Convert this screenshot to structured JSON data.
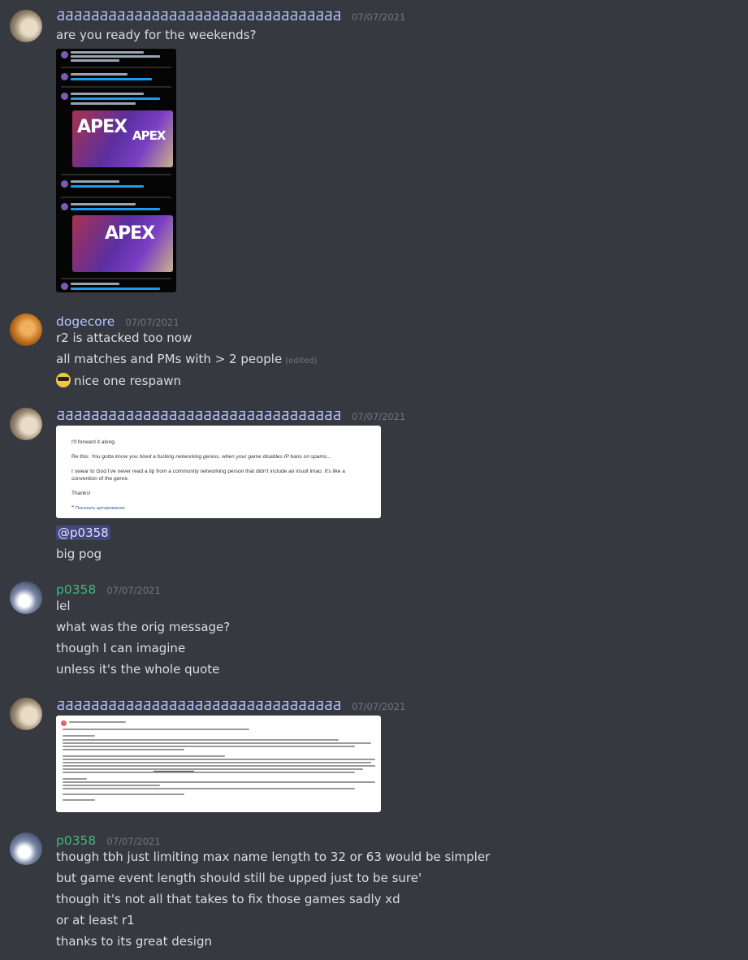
{
  "messages": [
    {
      "author": "ƋƋƋƋƋƋƋƋƋƋƋƋƋƋƋƋƋƋƋƋƋƋƋƋƋƋƋƋƋƋƋƋƋƋƋ",
      "author_display": "ƋƋƋƋƋƋƋƋƋƋƋƋƋƋƋƋƋƋƋƋƋƋƋƋƋƋƋƋƋƋƋƋƋ",
      "timestamp": "07/07/2021",
      "lines": [
        "are you ready for the weekends?"
      ],
      "attachment": "twitter-thread-screenshot"
    },
    {
      "author": "dogecore",
      "timestamp": "07/07/2021",
      "lines": [
        "r2 is attacked too now",
        "all matches and PMs with > 2 people",
        "nice one respawn"
      ],
      "edited_label": "(edited)"
    },
    {
      "author_display": "ƋƋƋƋƋƋƋƋƋƋƋƋƋƋƋƋƋƋƋƋƋƋƋƋƋƋƋƋƋƋƋƋƋ",
      "timestamp": "07/07/2021",
      "email": {
        "line1": "I'll forward it along.",
        "line2_prefix": "Re this: ",
        "line2_italic": "You gotta know you hired a fucking networking genius, when your game disables IP bans on spams...",
        "line3": "I swear to God I've never read a tip from a community networking person that didn't include an insult lmao. It's like a convention of the genre.",
        "line4": "Thanks!",
        "quote_link": "Показать цитирование"
      },
      "mention": "@p0358",
      "lines": [
        "big pog"
      ]
    },
    {
      "author": "p0358",
      "timestamp": "07/07/2021",
      "lines": [
        "lel",
        "what was the orig message?",
        "though I can imagine",
        "unless it's the whole quote"
      ]
    },
    {
      "author_display": "ƋƋƋƋƋƋƋƋƋƋƋƋƋƋƋƋƋƋƋƋƋƋƋƋƋƋƋƋƋƋƋƋƋ",
      "timestamp": "07/07/2021",
      "attachment": "long-email-screenshot"
    },
    {
      "author": "p0358",
      "timestamp": "07/07/2021",
      "lines": [
        "though tbh just limiting max name length to 32 or 63 would be simpler",
        "but game event length should still be upped just to be sure'",
        "though it's not all that takes to fix those games sadly xd",
        "or at least r1",
        "thanks to its great design"
      ]
    }
  ],
  "colors": {
    "background": "#36393f",
    "username_blue": "#b7c3ff",
    "username_green": "#43b581",
    "timestamp": "#72767d",
    "text": "#dcddde"
  }
}
